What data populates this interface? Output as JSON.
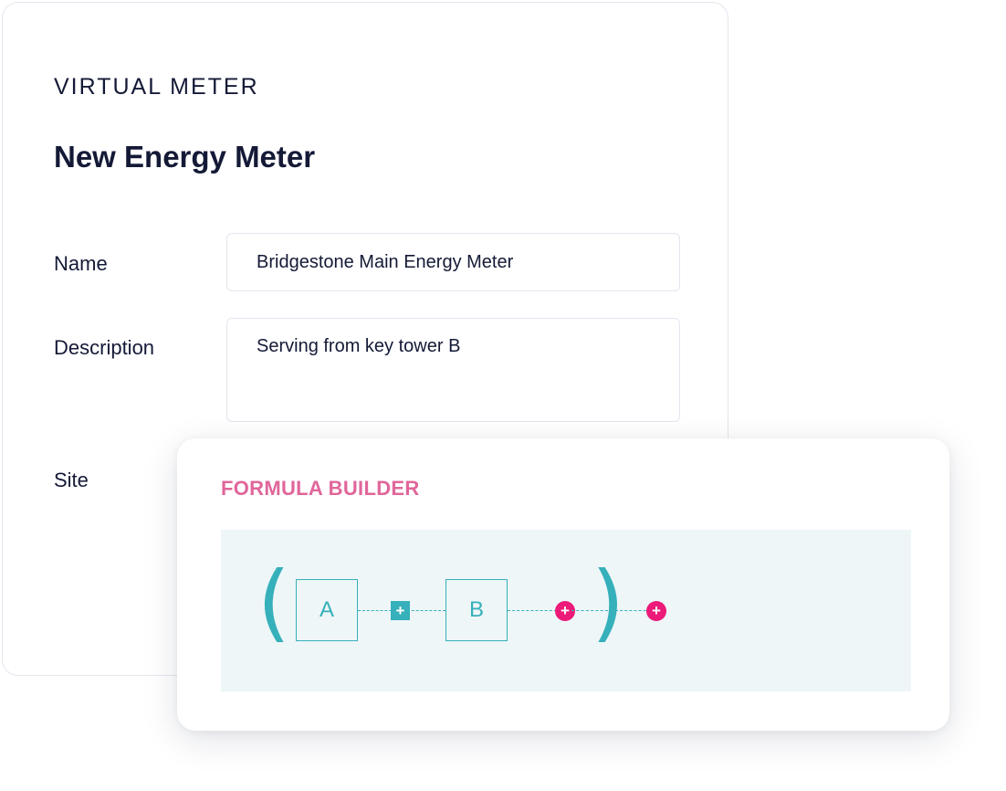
{
  "meter_card": {
    "eyebrow": "VIRTUAL METER",
    "title": "New Energy Meter",
    "fields": {
      "name": {
        "label": "Name",
        "value": "Bridgestone Main Energy Meter"
      },
      "description": {
        "label": "Description",
        "value": "Serving from key tower B"
      },
      "site": {
        "label": "Site"
      }
    }
  },
  "formula_builder": {
    "title": "FORMULA BUILDER",
    "open_paren": "(",
    "close_paren": ")",
    "operands": [
      "A",
      "B"
    ],
    "operator": "+",
    "add_symbol": "+",
    "colors": {
      "accent_teal": "#36b0ba",
      "accent_pink": "#ec1a78",
      "title_pink": "#e0669a",
      "canvas_bg": "#eef6f8"
    },
    "icons": {
      "operator": "plus-square-icon",
      "add": "plus-circle-icon"
    }
  }
}
